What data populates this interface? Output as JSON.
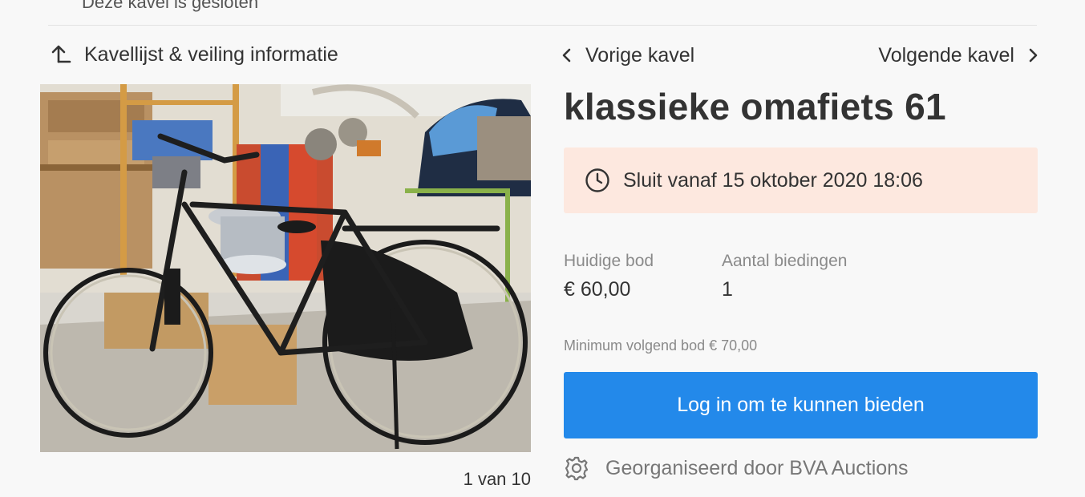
{
  "header": {
    "cut_off_text": "Deze kavel is gesloten"
  },
  "navigation": {
    "back_label": "Kavellijst & veiling informatie",
    "back_icon": "corner-up-left-icon",
    "prev_label": "Vorige kavel",
    "next_label": "Volgende kavel"
  },
  "gallery": {
    "image_alt": "bicycle-photo",
    "counter": "1 van 10"
  },
  "lot": {
    "title": "klassieke omafiets 61",
    "closing_text": "Sluit vanaf 15 oktober 2020 18:06",
    "closing_icon": "clock-icon"
  },
  "bidding": {
    "current_bid_label": "Huidige bod",
    "current_bid_value": "€ 60,00",
    "bid_count_label": "Aantal biedingen",
    "bid_count_value": "1",
    "min_next_bid": "Minimum volgend bod € 70,00",
    "login_button": "Log in om te kunnen bieden"
  },
  "organizer": {
    "text": "Georganiseerd door BVA Auctions",
    "icon": "gear-icon"
  },
  "colors": {
    "primary": "#2389ea",
    "closing_bg": "#fde8df",
    "background": "#f8f8f8"
  }
}
